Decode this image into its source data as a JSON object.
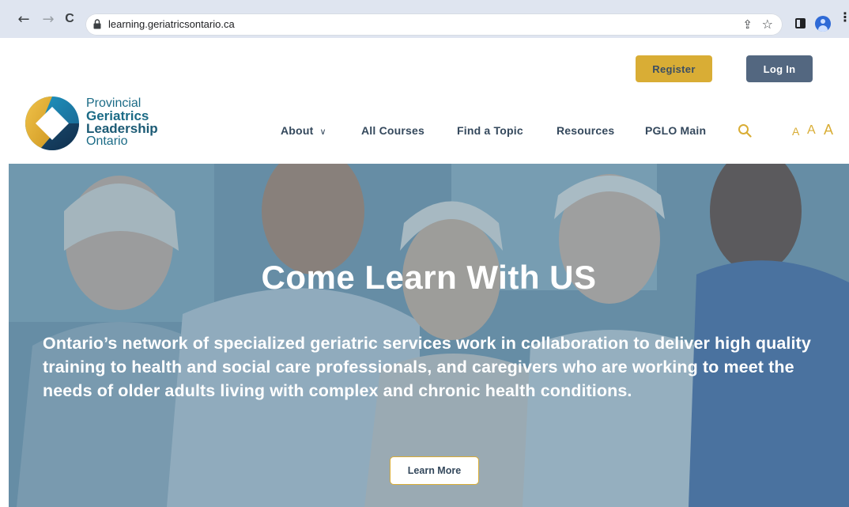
{
  "browser": {
    "url": "learning.geriatricsontario.ca",
    "back_icon": "arrow-left",
    "forward_icon": "arrow-right",
    "reload_icon": "reload",
    "back_glyph": "←",
    "forward_glyph": "→",
    "reload_glyph": "C",
    "share_glyph": "⇪",
    "star_glyph": "☆",
    "menu_glyph": "⋮"
  },
  "header": {
    "register_label": "Register",
    "login_label": "Log In",
    "logo_lines": [
      "Provincial",
      "Geriatrics",
      "Leadership",
      "Ontario"
    ],
    "nav": [
      {
        "label": "About",
        "has_dropdown": true,
        "caret": "∨"
      },
      {
        "label": "All Courses"
      },
      {
        "label": "Find a Topic"
      },
      {
        "label": "Resources"
      },
      {
        "label": "PGLO Main"
      }
    ],
    "text_size_labels": [
      "A",
      "A",
      "A"
    ],
    "colors": {
      "accent": "#d9ad35",
      "nav_text": "#34485c",
      "login_bg": "#536780"
    }
  },
  "hero": {
    "title": "Come Learn With US",
    "subtitle": "Ontario’s network of specialized geriatric services work in collaboration to deliver high quality training to health and social care professionals, and caregivers who are working to meet the needs of older adults living with complex and chronic health conditions.",
    "button_label": "Learn More"
  }
}
